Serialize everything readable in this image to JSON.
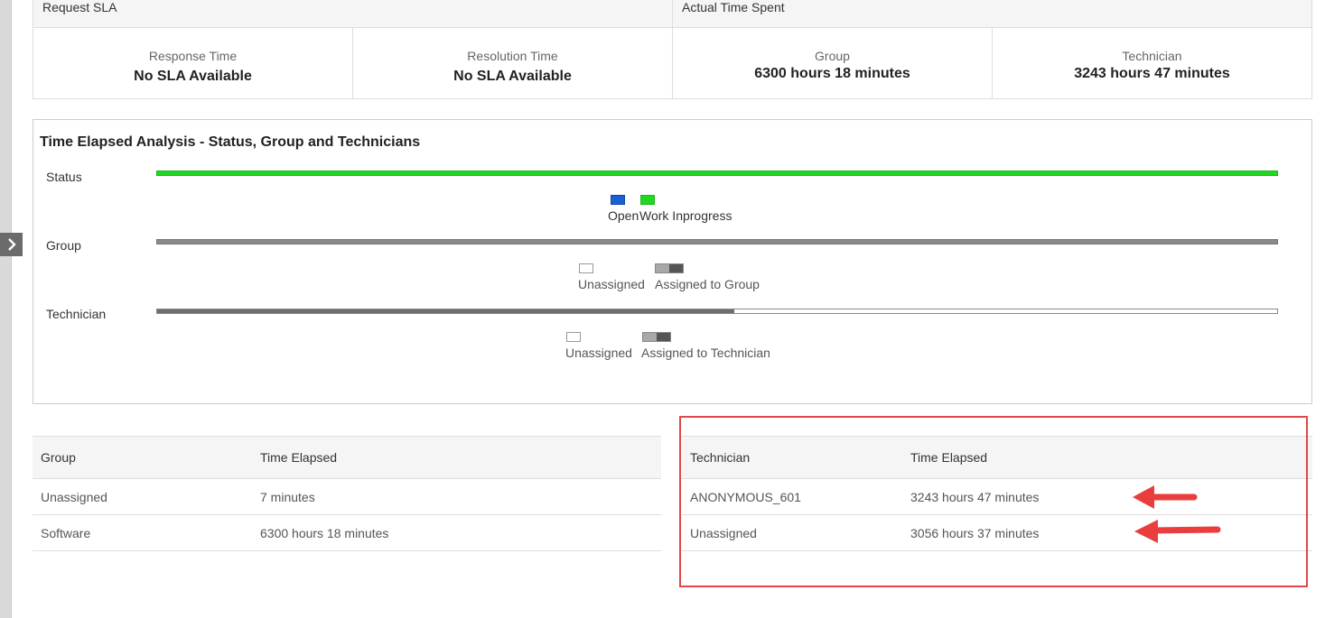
{
  "sla": {
    "request_sla_title": "Request SLA",
    "actual_time_title": "Actual Time Spent",
    "response_label": "Response Time",
    "response_value": "No SLA Available",
    "resolution_label": "Resolution Time",
    "resolution_value": "No SLA Available",
    "group_label": "Group",
    "group_value": "6300 hours 18 minutes",
    "technician_label": "Technician",
    "technician_value": "3243 hours 47 minutes"
  },
  "analysis": {
    "title": "Time Elapsed Analysis - Status, Group and Technicians",
    "status": {
      "label": "Status",
      "legend": [
        {
          "label": "Open",
          "color": "#1a5fd6"
        },
        {
          "label": "Work Inprogress",
          "color": "#22d622"
        }
      ]
    },
    "group": {
      "label": "Group",
      "legend": [
        {
          "label": "Unassigned"
        },
        {
          "label": "Assigned to Group"
        }
      ]
    },
    "technician": {
      "label": "Technician",
      "assigned_fraction": 0.515,
      "legend": [
        {
          "label": "Unassigned"
        },
        {
          "label": "Assigned to Technician"
        }
      ]
    }
  },
  "group_table": {
    "headers": [
      "Group",
      "Time Elapsed"
    ],
    "rows": [
      [
        "Unassigned",
        "7 minutes"
      ],
      [
        "Software",
        "6300 hours 18 minutes"
      ]
    ]
  },
  "technician_table": {
    "headers": [
      "Technician",
      "Time Elapsed"
    ],
    "rows": [
      [
        "ANONYMOUS_601",
        "3243 hours 47 minutes"
      ],
      [
        "Unassigned",
        "3056 hours 37 minutes"
      ]
    ]
  },
  "colors": {
    "status_bar": "#22d622",
    "highlight": "#e04848",
    "arrow": "#ea3d3d"
  }
}
